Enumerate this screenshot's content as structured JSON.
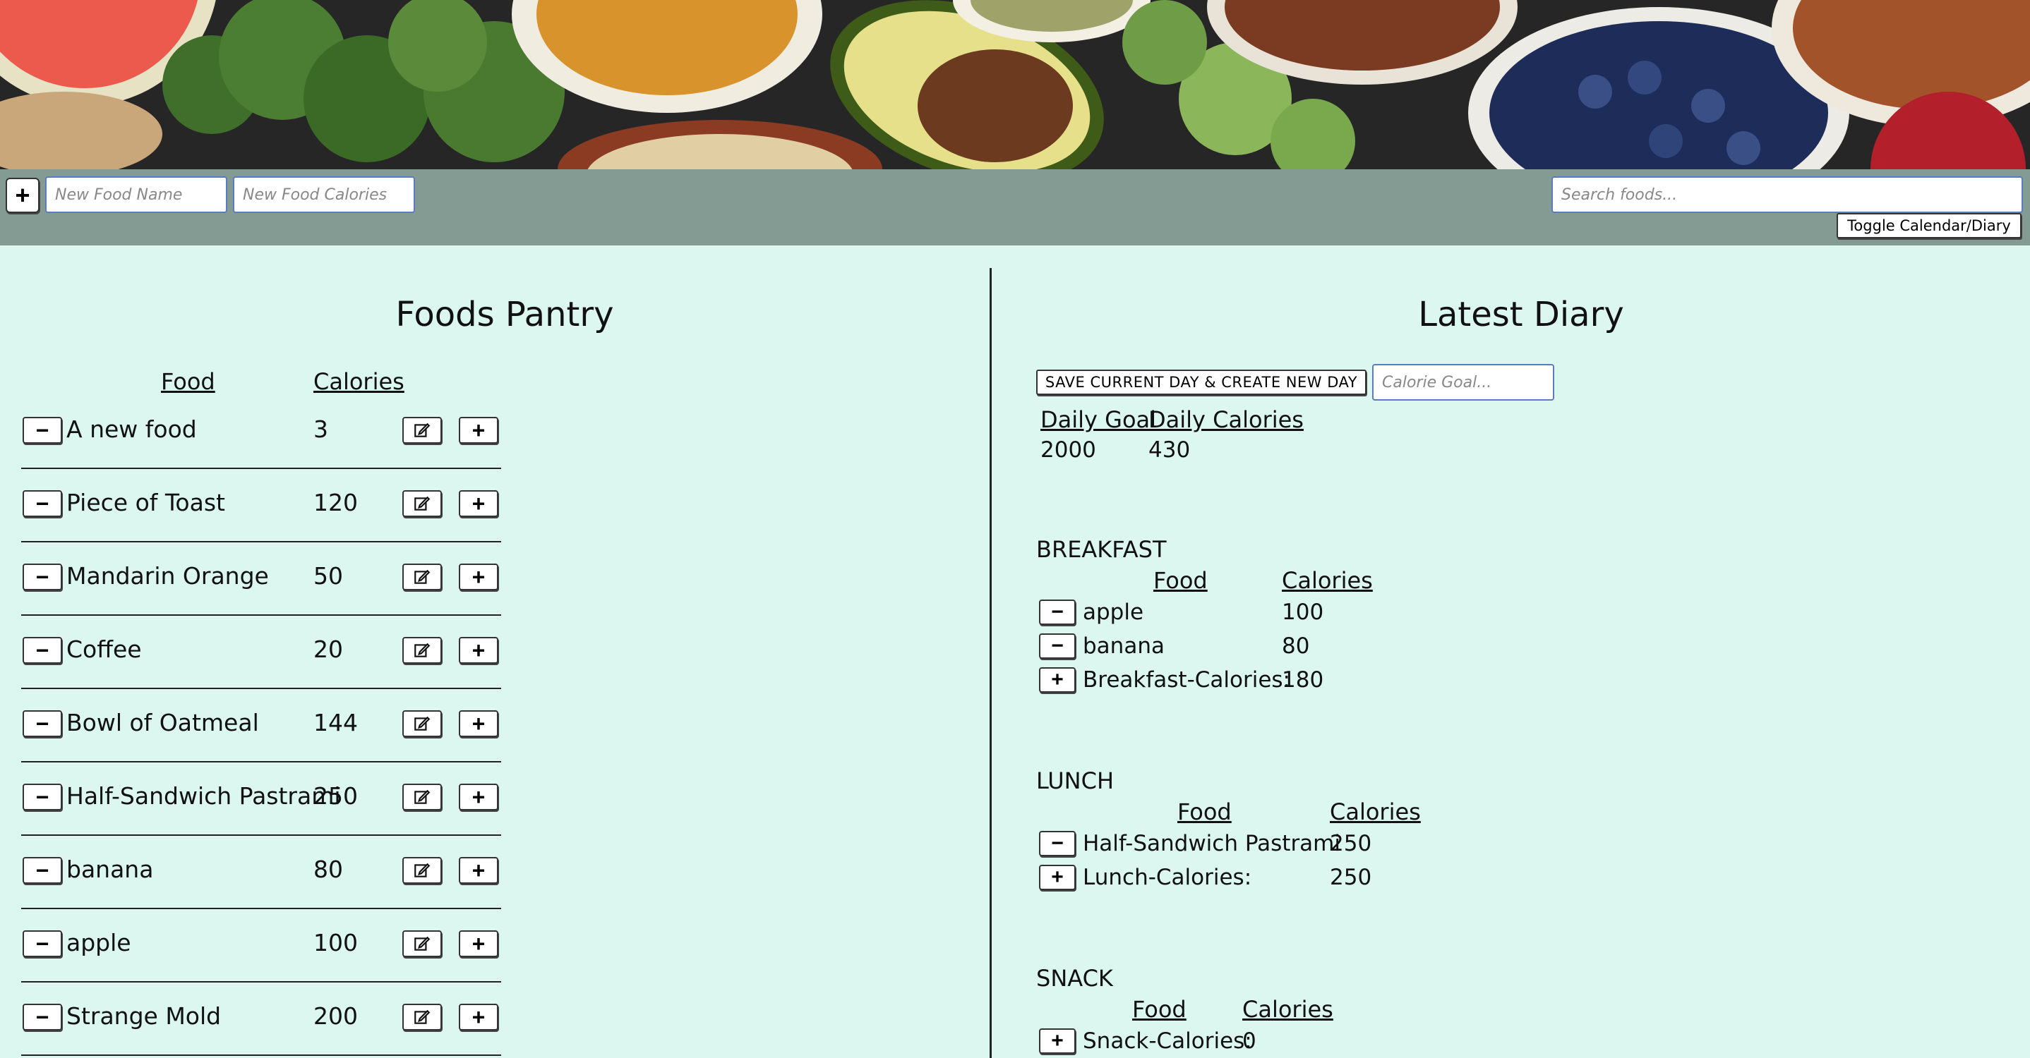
{
  "toolbar": {
    "add_icon": "plus-icon",
    "new_food_name_placeholder": "New Food Name",
    "new_food_calories_placeholder": "New Food Calories",
    "search_placeholder": "Search foods...",
    "toggle_label": "Toggle Calendar/Diary"
  },
  "pantry": {
    "title": "Foods Pantry",
    "col_food": "Food",
    "col_calories": "Calories",
    "items": [
      {
        "name": "A new food",
        "calories": "3"
      },
      {
        "name": "Piece of Toast",
        "calories": "120"
      },
      {
        "name": "Mandarin Orange",
        "calories": "50"
      },
      {
        "name": "Coffee",
        "calories": "20"
      },
      {
        "name": "Bowl of Oatmeal",
        "calories": "144"
      },
      {
        "name": "Half-Sandwich Pastrami",
        "calories": "250"
      },
      {
        "name": "banana",
        "calories": "80"
      },
      {
        "name": "apple",
        "calories": "100"
      },
      {
        "name": "Strange Mold",
        "calories": "200"
      }
    ]
  },
  "diary": {
    "title": "Latest Diary",
    "save_label": "SAVE CURRENT DAY & CREATE NEW DAY",
    "goal_placeholder": "Calorie Goal...",
    "daily_goal_head": "Daily Goal",
    "daily_cal_head": "Daily Calories",
    "daily_goal": "2000",
    "daily_calories": "430",
    "meals": {
      "breakfast": {
        "label": "BREAKFAST",
        "col_food": "Food",
        "col_calories": "Calories",
        "items": [
          {
            "name": "apple",
            "calories": "100"
          },
          {
            "name": "banana",
            "calories": "80"
          }
        ],
        "total_label": "Breakfast-Calories:",
        "total": "180"
      },
      "lunch": {
        "label": "LUNCH",
        "col_food": "Food",
        "col_calories": "Calories",
        "items": [
          {
            "name": "Half-Sandwich Pastrami",
            "calories": "250"
          }
        ],
        "total_label": "Lunch-Calories:",
        "total": "250"
      },
      "snack": {
        "label": "SNACK",
        "col_food": "Food",
        "col_calories": "Calories",
        "items": [],
        "total_label": "Snack-Calories:",
        "total": "0"
      }
    }
  },
  "colors": {
    "background": "#dcf7f0",
    "toolbar": "#839b93",
    "input_border": "#5a7cc0"
  }
}
